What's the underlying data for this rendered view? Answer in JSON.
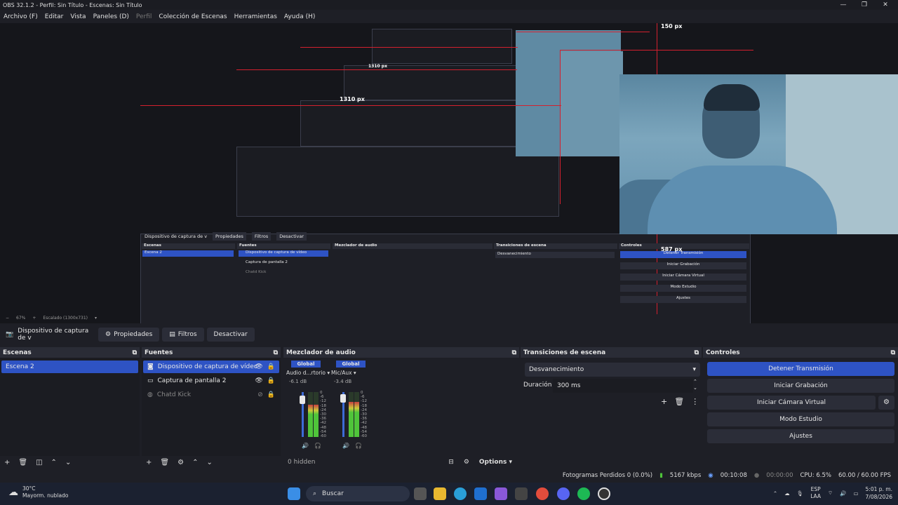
{
  "window": {
    "title": "OBS 32.1.2 - Perfil: Sin Título - Escenas: Sin Título",
    "minimize": "—",
    "maximize": "❐",
    "close": "✕"
  },
  "menu": [
    {
      "label": "Archivo (F)",
      "disabled": false
    },
    {
      "label": "Editar",
      "disabled": false
    },
    {
      "label": "Vista",
      "disabled": false
    },
    {
      "label": "Paneles (D)",
      "disabled": false
    },
    {
      "label": "Perfil",
      "disabled": true
    },
    {
      "label": "Colección de Escenas",
      "disabled": false
    },
    {
      "label": "Herramientas",
      "disabled": false
    },
    {
      "label": "Ayuda (H)",
      "disabled": false
    }
  ],
  "preview": {
    "px_labels": [
      "150 px",
      "1310 px",
      "1310 px",
      "587 px"
    ],
    "zoom": "67%",
    "scaled": "Escalado (1300x731)"
  },
  "source_toolbar": {
    "selected_source": "Dispositivo de captura de v",
    "properties": "Propiedades",
    "filters": "Filtros",
    "deactivate": "Desactivar"
  },
  "scenes": {
    "title": "Escenas",
    "items": [
      "Escena 2"
    ]
  },
  "sources": {
    "title": "Fuentes",
    "items": [
      {
        "label": "Dispositivo de captura de vídeo",
        "icon": "camera-icon",
        "selected": true,
        "visible": true
      },
      {
        "label": "Captura de pantalla 2",
        "icon": "monitor-icon",
        "selected": false,
        "visible": true
      },
      {
        "label": "Chatd Kick",
        "icon": "globe-icon",
        "selected": false,
        "visible": false
      }
    ]
  },
  "mixer": {
    "title": "Mezclador de audio",
    "channels": [
      {
        "tag": "Global",
        "name": "Audio d...rtorio",
        "db": "-6.1 dB",
        "level": 0.72
      },
      {
        "tag": "Global",
        "name": "Mic/Aux",
        "db": "-3.4 dB",
        "level": 0.78
      }
    ],
    "scale": [
      "0",
      "-6",
      "-12",
      "-18",
      "-24",
      "-30",
      "-36",
      "-42",
      "-48",
      "-54",
      "-60"
    ],
    "hidden": "0 hidden",
    "options": "Options"
  },
  "transitions": {
    "title": "Transiciones de escena",
    "selected": "Desvanecimiento",
    "duration_label": "Duración",
    "duration": "300 ms"
  },
  "controls": {
    "title": "Controles",
    "stop_stream": "Detener Transmisión",
    "start_recording": "Iniciar Grabación",
    "start_virtual_cam": "Iniciar Cámara Virtual",
    "studio_mode": "Modo Estudio",
    "settings": "Ajustes"
  },
  "status": {
    "dropped": "Fotogramas Perdidos 0 (0.0%)",
    "bitrate": "5167 kbps",
    "stream_time": "00:10:08",
    "rec_time": "00:00:00",
    "cpu": "CPU: 6.5%",
    "fps": "60.00 / 60.00 FPS"
  },
  "taskbar": {
    "temp": "30°C",
    "weather": "Mayorm. nublado",
    "search": "Buscar",
    "lang": "ESP",
    "lang2": "LAA",
    "time": "5:01 p. m.",
    "date": "7/08/2026"
  }
}
